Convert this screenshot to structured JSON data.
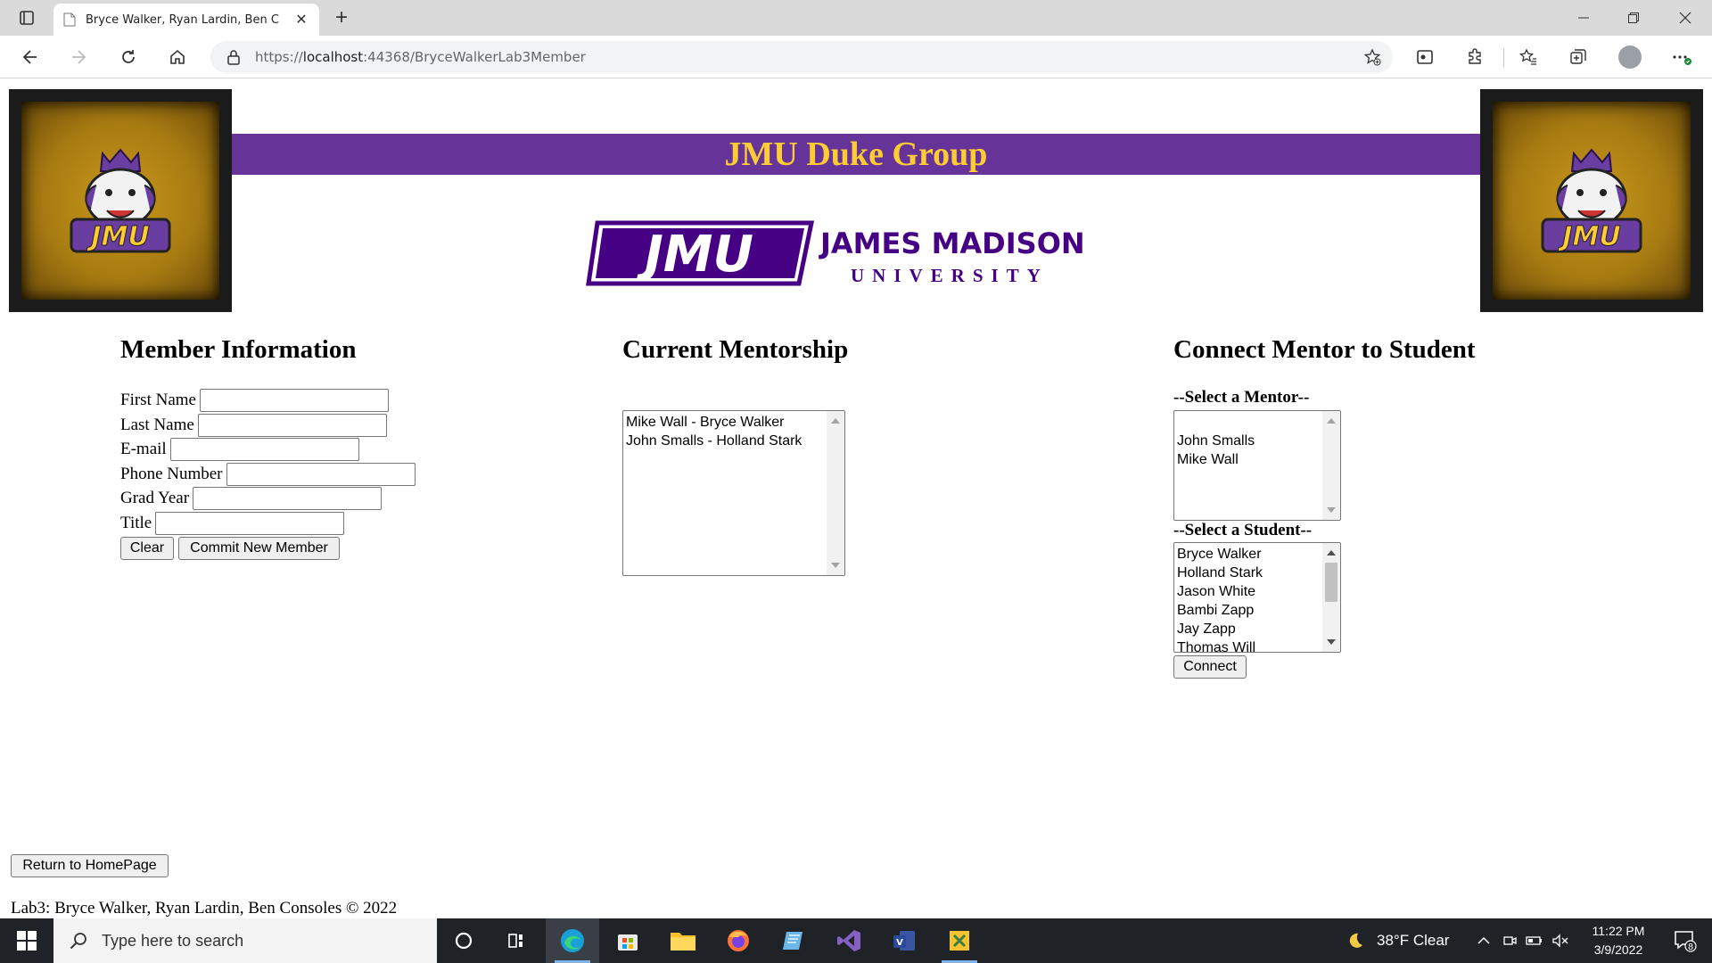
{
  "browser": {
    "tab_title": "Bryce Walker, Ryan Lardin, Ben C",
    "url_scheme": "https://",
    "url_host": "localhost",
    "url_path": ":44368/BryceWalkerLab3Member",
    "new_tab_symbol": "+",
    "close_symbol": "✕"
  },
  "page": {
    "banner_title": "JMU Duke Group",
    "university_wordmark": "JMU",
    "university_name_line1": "JAMES MADISON",
    "university_name_line2": "UNIVERSITY",
    "logo_text": "JMU"
  },
  "member_info": {
    "title": "Member Information",
    "fields": [
      {
        "label": "First Name",
        "value": ""
      },
      {
        "label": "Last Name",
        "value": ""
      },
      {
        "label": "E-mail",
        "value": ""
      },
      {
        "label": "Phone Number",
        "value": ""
      },
      {
        "label": "Grad Year",
        "value": ""
      },
      {
        "label": "Title",
        "value": ""
      }
    ],
    "clear_label": "Clear",
    "commit_label": "Commit New Member"
  },
  "mentorship": {
    "title": "Current Mentorship",
    "items": [
      "Mike Wall - Bryce Walker",
      "John Smalls - Holland Stark"
    ]
  },
  "connect": {
    "title": "Connect Mentor to Student",
    "mentor_label": "--Select a Mentor--",
    "mentors": [
      "",
      "John Smalls",
      "Mike Wall"
    ],
    "student_label": "--Select a Student--",
    "students": [
      "Bryce Walker",
      "Holland Stark",
      "Jason White",
      "Bambi Zapp",
      "Jay Zapp",
      "Thomas Will"
    ],
    "connect_label": "Connect"
  },
  "return_label": "Return to HomePage",
  "footer": "Lab3: Bryce Walker, Ryan Lardin, Ben Consoles © 2022",
  "taskbar": {
    "search_placeholder": "Type here to search",
    "weather": "38°F  Clear",
    "time": "11:22 PM",
    "date": "3/9/2022",
    "notification_count": "8"
  },
  "colors": {
    "jmu_purple": "#663399",
    "jmu_gold": "#ffcc33",
    "taskbar": "#1f2328"
  }
}
